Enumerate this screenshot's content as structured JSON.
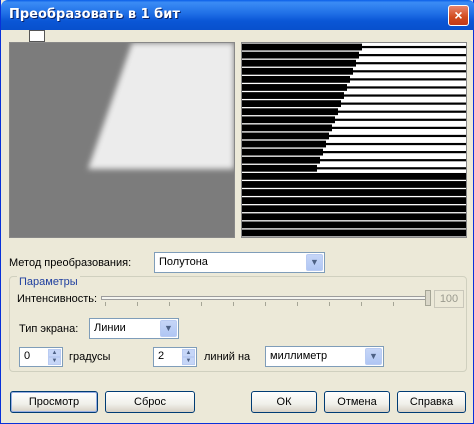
{
  "window": {
    "title": "Преобразовать в 1 бит",
    "close_glyph": "×"
  },
  "toolbar": {
    "preview_toggle_icon": "monitor-icon"
  },
  "method": {
    "label": "Метод преобразования:",
    "value": "Полутона"
  },
  "params": {
    "legend": "Параметры",
    "intensity_label": "Интенсивность:",
    "intensity_value": "100",
    "screen_type_label": "Тип экрана:",
    "screen_type_value": "Линии",
    "angle_value": "0",
    "angle_label": "градусы",
    "lines_value": "2",
    "lines_label": "линий на",
    "unit_value": "миллиметр"
  },
  "buttons": {
    "preview": "Просмотр",
    "reset": "Сброс",
    "ok": "ОК",
    "cancel": "Отмена",
    "help": "Справка"
  }
}
